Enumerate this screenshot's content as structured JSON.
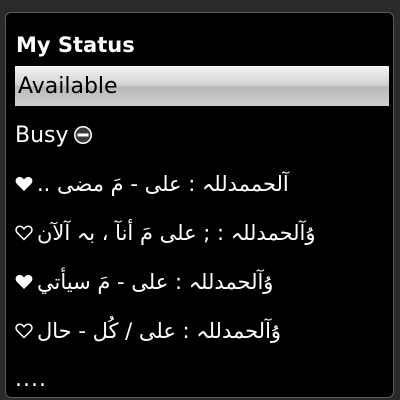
{
  "menu": {
    "title": "My Status",
    "items": [
      {
        "label": "Available",
        "selected": true,
        "icon": null
      },
      {
        "label": "Busy",
        "selected": false,
        "icon": "busy-icon"
      },
      {
        "label": "آلحممدللہ : علی - مَ مضی ..",
        "selected": false,
        "icon": "heart-filled-icon"
      },
      {
        "label": "ۇآلحمدللہ : ; علی مَ أنآ ، بہ آلآن",
        "selected": false,
        "icon": "heart-outline-icon"
      },
      {
        "label": "ۇآلحمدللہ : علی - مَ سيأتي",
        "selected": false,
        "icon": "heart-filled-icon"
      },
      {
        "label": "ۇآلحمدللہ : علی / کُل - حال",
        "selected": false,
        "icon": "heart-outline-icon"
      },
      {
        "label": "....",
        "selected": false,
        "icon": null
      }
    ]
  }
}
